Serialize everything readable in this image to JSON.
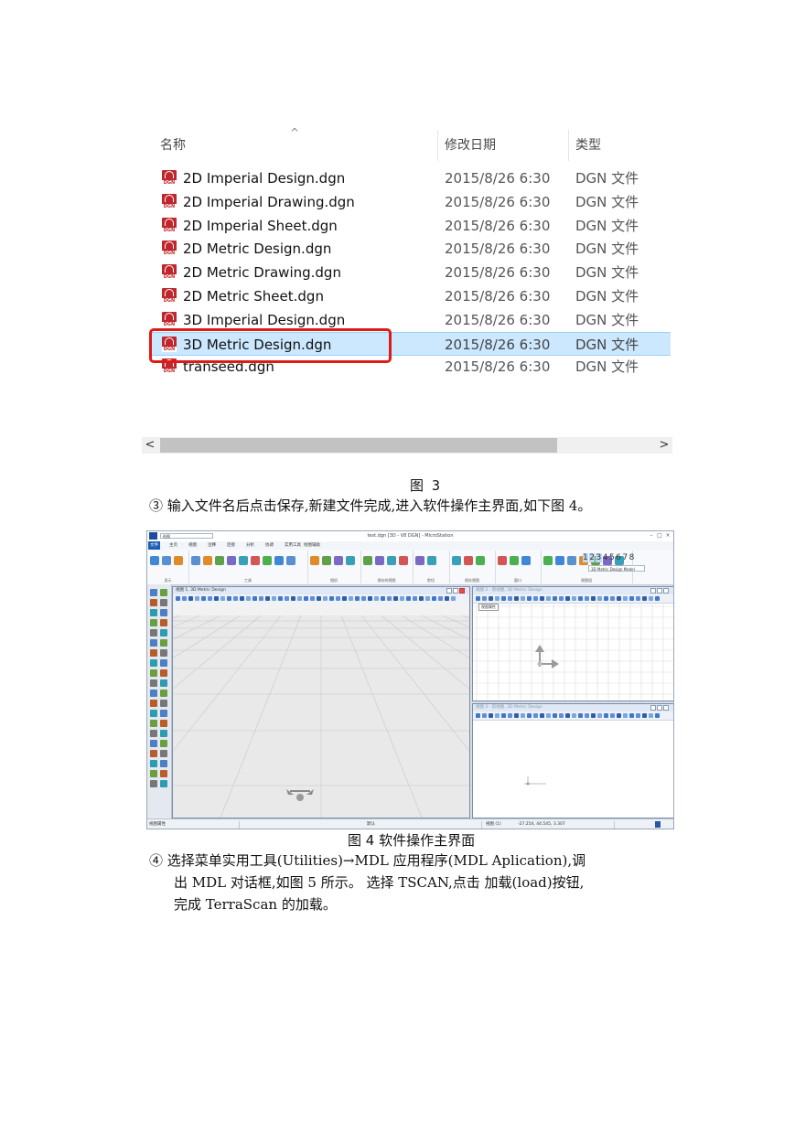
{
  "explorer": {
    "columns": {
      "name": "名称",
      "modified": "修改日期",
      "type": "类型"
    },
    "sort_caret": "^",
    "file_icon_tag": "DGN",
    "files": [
      {
        "name": "2D Imperial Design.dgn",
        "date": "2015/8/26 6:30",
        "type": "DGN 文件",
        "selected": false
      },
      {
        "name": "2D Imperial Drawing.dgn",
        "date": "2015/8/26 6:30",
        "type": "DGN 文件",
        "selected": false
      },
      {
        "name": "2D Imperial Sheet.dgn",
        "date": "2015/8/26 6:30",
        "type": "DGN 文件",
        "selected": false
      },
      {
        "name": "2D Metric Design.dgn",
        "date": "2015/8/26 6:30",
        "type": "DGN 文件",
        "selected": false
      },
      {
        "name": "2D Metric Drawing.dgn",
        "date": "2015/8/26 6:30",
        "type": "DGN 文件",
        "selected": false
      },
      {
        "name": "2D Metric Sheet.dgn",
        "date": "2015/8/26 6:30",
        "type": "DGN 文件",
        "selected": false
      },
      {
        "name": "3D Imperial Design.dgn",
        "date": "2015/8/26 6:30",
        "type": "DGN 文件",
        "selected": false
      },
      {
        "name": "3D Metric Design.dgn",
        "date": "2015/8/26 6:30",
        "type": "DGN 文件",
        "selected": true
      },
      {
        "name": "transeed.dgn",
        "date": "2015/8/26 6:30",
        "type": "DGN 文件",
        "selected": false
      }
    ],
    "scroll_left": "<",
    "scroll_right": ">",
    "highlight_color": "#e01818",
    "selection_color": "#cce8ff"
  },
  "fig3_caption": "图 3",
  "step3_text": "③ 输入文件名后点击保存,新建文件完成,进入软件操作主界面,如下图 4。",
  "microstation": {
    "search_placeholder": "绘图",
    "window_title": "test.dgn [3D - V8 DGN] - MicroStation",
    "menu_tabs": [
      "文件",
      "主页",
      "视图",
      "注释",
      "连接",
      "分析",
      "协调",
      "实用工具",
      "绘图辅助"
    ],
    "ribbon_groups": [
      "显示",
      "工具",
      "相机",
      "保存的视图",
      "剪切",
      "保存视图",
      "窗口",
      "视图组"
    ],
    "levels": [
      "1",
      "2",
      "3",
      "4",
      "5",
      "6",
      "7",
      "8"
    ],
    "model_select": "3D Metric Design Model",
    "view1_title": "视图 1, 3D Metric Design",
    "view2_title": "视图 2 - 俯视图, 3D Metric Design",
    "view3_title": "视图 3 - 前视图, 3D Metric Design",
    "tooltip": "视图属性",
    "status_left": "视图属性",
    "status_mid": "默认",
    "status_view": "视图 (1)",
    "status_coords": "-27.254, 44.545, 3.307"
  },
  "fig4_caption": "图 4  软件操作主界面",
  "step4_line1": "④ 选择菜单实用工具(Utilities)→MDL 应用程序(MDL Aplication),调",
  "step4_line2": "出 MDL 对话框,如图 5 所示。 选择 TSCAN,点击 加载(load)按钮,",
  "step4_line3": "完成 TerraScan 的加载。"
}
